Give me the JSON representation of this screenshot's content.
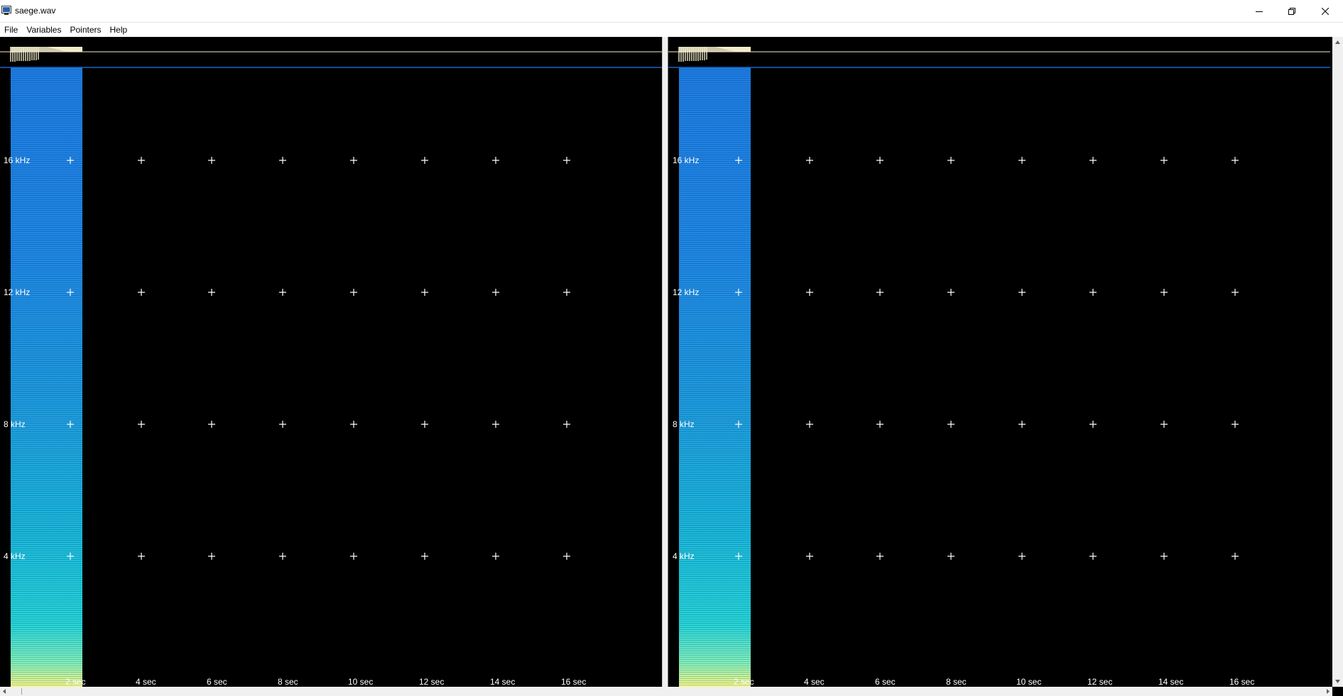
{
  "window": {
    "title": "saege.wav",
    "minimize_icon": "minimize-icon",
    "restore_icon": "restore-icon",
    "close_icon": "close-icon"
  },
  "menu": {
    "items": [
      "File",
      "Variables",
      "Pointers",
      "Help"
    ]
  },
  "panes": {
    "left": {
      "frequency_labels": [
        "16 kHz",
        "12 kHz",
        "8 kHz",
        "4 kHz"
      ],
      "time_labels": [
        "2 sec",
        "4 sec",
        "6 sec",
        "8 sec",
        "10 sec",
        "12 sec",
        "14 sec",
        "16 sec"
      ]
    },
    "right": {
      "frequency_labels": [
        "16 kHz",
        "12 kHz",
        "8 kHz",
        "4 kHz"
      ],
      "time_labels": [
        "2 sec",
        "4 sec",
        "6 sec",
        "8 sec",
        "10 sec",
        "12 sec",
        "14 sec",
        "16 sec"
      ]
    }
  },
  "colors": {
    "spectrogram_top": "#1e7ee6",
    "spectrogram_bottom": "#f3f58a",
    "waveform": "#f2eccc",
    "cursor_line": "#1565c0",
    "grid_marker": "#ffffff"
  }
}
